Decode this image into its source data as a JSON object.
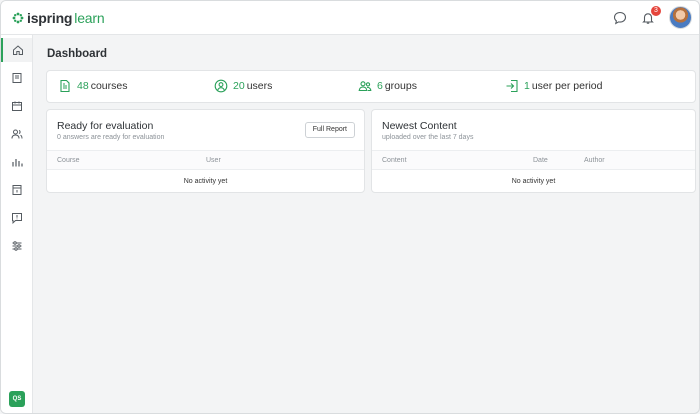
{
  "header": {
    "logo_a": "ispring",
    "logo_b": "learn",
    "notification_count": "3"
  },
  "sidebar": {
    "items": [
      {
        "icon": "home-icon",
        "active": true
      },
      {
        "icon": "book-icon",
        "active": false
      },
      {
        "icon": "calendar-icon",
        "active": false
      },
      {
        "icon": "users-icon",
        "active": false
      },
      {
        "icon": "bar-chart-icon",
        "active": false
      },
      {
        "icon": "calendar-page-icon",
        "active": false
      },
      {
        "icon": "feedback-icon",
        "active": false
      },
      {
        "icon": "settings-sliders-icon",
        "active": false
      }
    ],
    "user_initials": "QS"
  },
  "page": {
    "title": "Dashboard"
  },
  "stats": [
    {
      "num": "48",
      "label": "courses",
      "icon": "document-icon"
    },
    {
      "num": "20",
      "label": "users",
      "icon": "user-circle-icon"
    },
    {
      "num": "6",
      "label": "groups",
      "icon": "group-icon"
    },
    {
      "num": "1",
      "label": "user per period",
      "icon": "sign-in-icon"
    }
  ],
  "evaluation": {
    "title": "Ready for evaluation",
    "subtitle": "0 answers are ready for evaluation",
    "button": "Full Report",
    "columns": [
      "Course",
      "User"
    ],
    "empty": "No activity yet"
  },
  "newest": {
    "title": "Newest Content",
    "subtitle": "uploaded over the last 7 days",
    "columns": [
      "Content",
      "Date",
      "Author"
    ],
    "empty": "No activity yet"
  },
  "colors": {
    "accent": "#2ba15a",
    "badge": "#e5453c"
  }
}
